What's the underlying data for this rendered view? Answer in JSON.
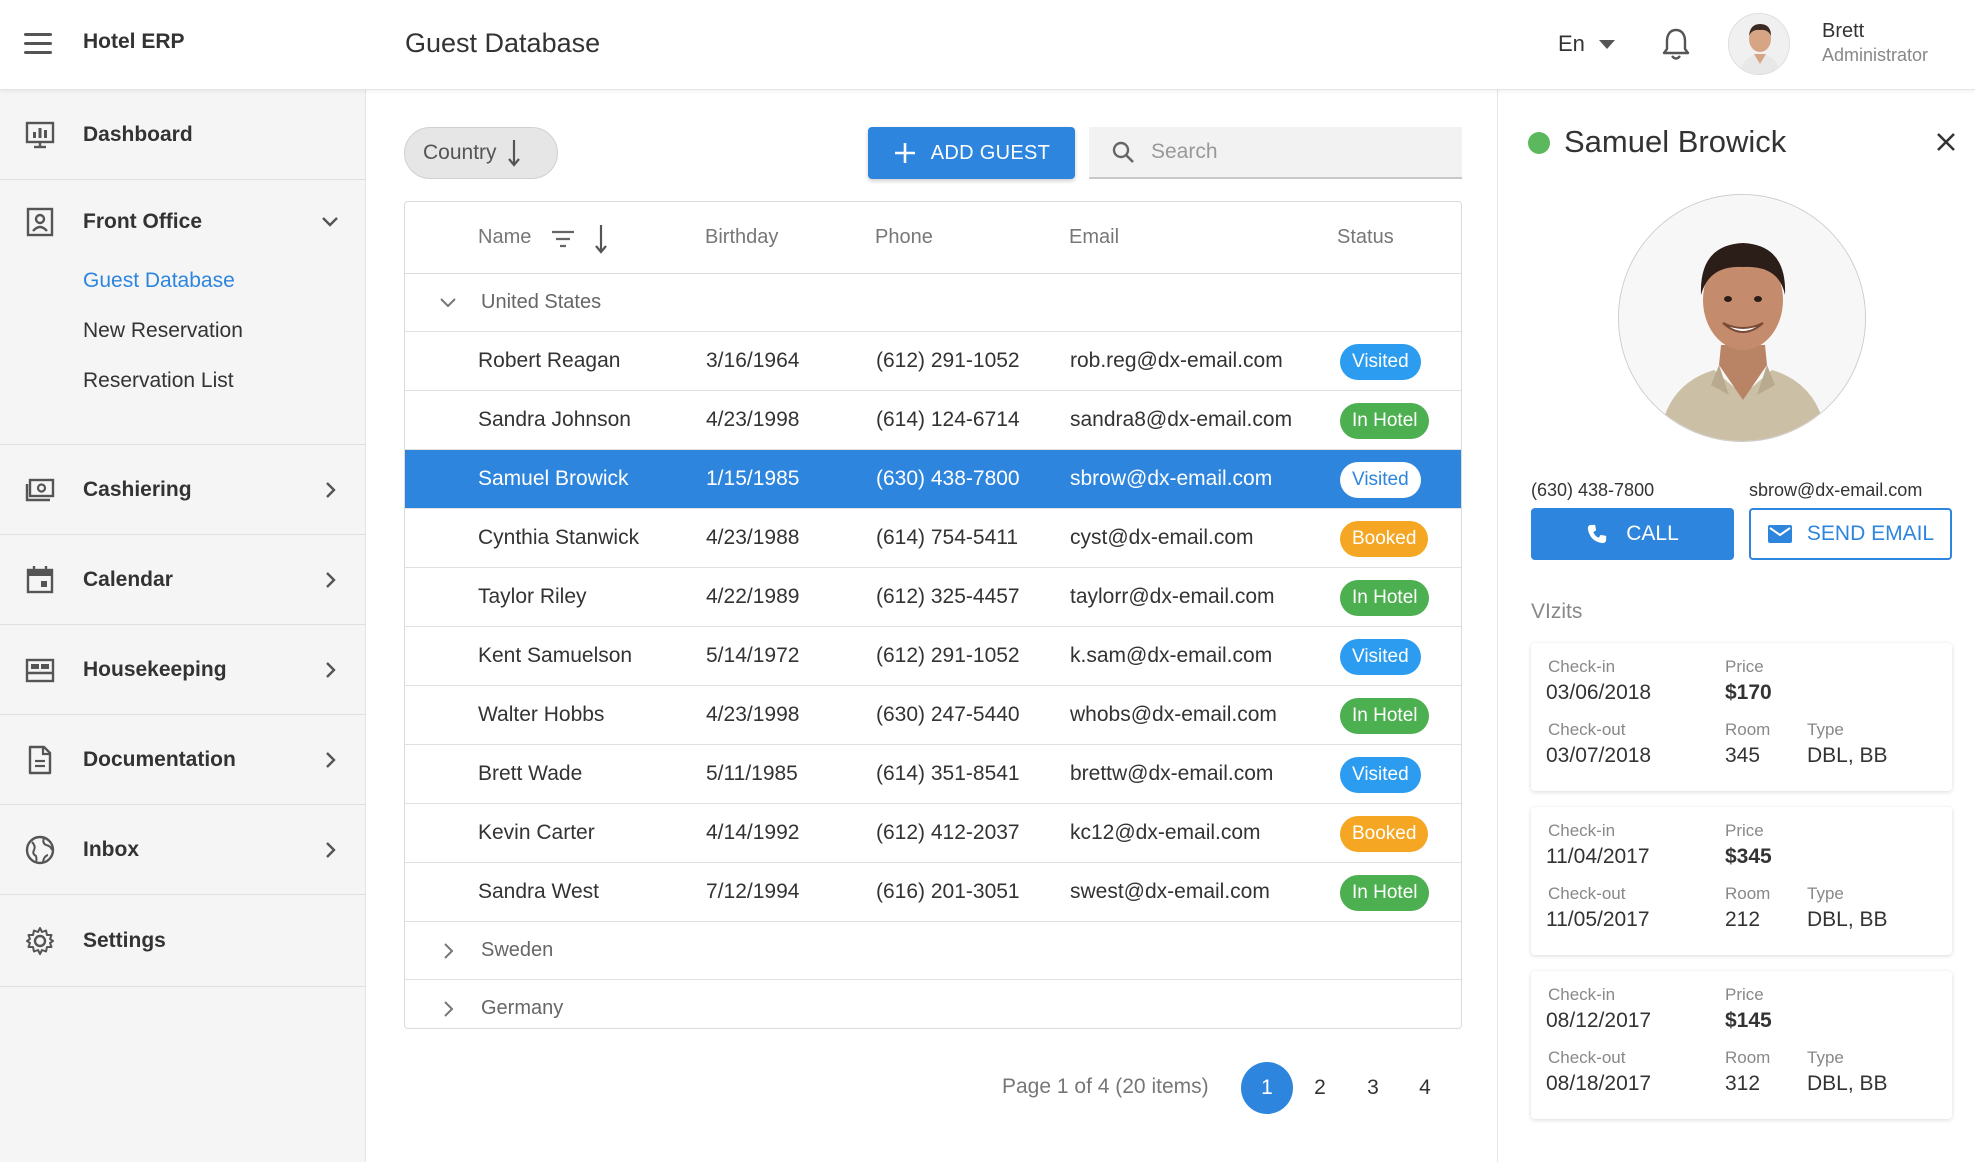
{
  "header": {
    "app_title": "Hotel ERP",
    "page_title": "Guest Database",
    "language": "En",
    "user_name": "Brett",
    "user_role": "Administrator"
  },
  "sidebar": {
    "items": [
      {
        "label": "Dashboard",
        "icon": "dashboard-icon"
      },
      {
        "label": "Front Office",
        "icon": "front-office-icon"
      },
      {
        "label": "Cashiering",
        "icon": "cashiering-icon"
      },
      {
        "label": "Calendar",
        "icon": "calendar-icon"
      },
      {
        "label": "Housekeeping",
        "icon": "housekeeping-icon"
      },
      {
        "label": "Documentation",
        "icon": "documentation-icon"
      },
      {
        "label": "Inbox",
        "icon": "inbox-icon"
      },
      {
        "label": "Settings",
        "icon": "settings-icon"
      }
    ],
    "front_office_sub": [
      "Guest Database",
      "New Reservation",
      "Reservation List"
    ]
  },
  "toolbar": {
    "country_chip": "Country",
    "add_guest": "ADD GUEST",
    "search_placeholder": "Search"
  },
  "grid": {
    "columns": [
      "Name",
      "Birthday",
      "Phone",
      "Email",
      "Status"
    ],
    "groups": [
      "United States",
      "Sweden",
      "Germany"
    ],
    "rows": [
      {
        "name": "Robert Reagan",
        "birthday": "3/16/1964",
        "phone": "(612) 291-1052",
        "email": "rob.reg@dx-email.com",
        "status": "Visited"
      },
      {
        "name": "Sandra Johnson",
        "birthday": "4/23/1998",
        "phone": "(614) 124-6714",
        "email": "sandra8@dx-email.com",
        "status": "In Hotel"
      },
      {
        "name": "Samuel Browick",
        "birthday": "1/15/1985",
        "phone": "(630) 438-7800",
        "email": "sbrow@dx-email.com",
        "status": "Visited"
      },
      {
        "name": "Cynthia Stanwick",
        "birthday": "4/23/1988",
        "phone": "(614) 754-5411",
        "email": "cyst@dx-email.com",
        "status": "Booked"
      },
      {
        "name": "Taylor Riley",
        "birthday": "4/22/1989",
        "phone": "(612) 325-4457",
        "email": "taylorr@dx-email.com",
        "status": "In Hotel"
      },
      {
        "name": "Kent Samuelson",
        "birthday": "5/14/1972",
        "phone": "(612) 291-1052",
        "email": "k.sam@dx-email.com",
        "status": "Visited"
      },
      {
        "name": "Walter Hobbs",
        "birthday": "4/23/1998",
        "phone": "(630) 247-5440",
        "email": "whobs@dx-email.com",
        "status": "In Hotel"
      },
      {
        "name": "Brett Wade",
        "birthday": "5/11/1985",
        "phone": "(614) 351-8541",
        "email": "brettw@dx-email.com",
        "status": "Visited"
      },
      {
        "name": "Kevin Carter",
        "birthday": "4/14/1992",
        "phone": "(612) 412-2037",
        "email": "kc12@dx-email.com",
        "status": "Booked"
      },
      {
        "name": "Sandra West",
        "birthday": "7/12/1994",
        "phone": "(616) 201-3051",
        "email": "swest@dx-email.com",
        "status": "In Hotel"
      }
    ],
    "status_colors": {
      "Visited": "#2b9cf0",
      "In Hotel": "#4caf50",
      "Booked": "#f5a623"
    },
    "selected_accent": "#2d85de"
  },
  "pager": {
    "info": "Page 1 of 4 (20 items)",
    "pages": [
      "1",
      "2",
      "3",
      "4"
    ]
  },
  "detail": {
    "name": "Samuel Browick",
    "phone": "(630) 438-7800",
    "email": "sbrow@dx-email.com",
    "call_label": "CALL",
    "email_label": "SEND EMAIL",
    "visits_title": "VIzits",
    "labels": {
      "checkin": "Check-in",
      "checkout": "Check-out",
      "price": "Price",
      "room": "Room",
      "type": "Type"
    },
    "visits": [
      {
        "checkin": "03/06/2018",
        "checkout": "03/07/2018",
        "price": "$170",
        "room": "345",
        "type": "DBL, BB"
      },
      {
        "checkin": "11/04/2017",
        "checkout": "11/05/2017",
        "price": "$345",
        "room": "212",
        "type": "DBL, BB"
      },
      {
        "checkin": "08/12/2017",
        "checkout": "08/18/2017",
        "price": "$145",
        "room": "312",
        "type": "DBL, BB"
      }
    ]
  }
}
